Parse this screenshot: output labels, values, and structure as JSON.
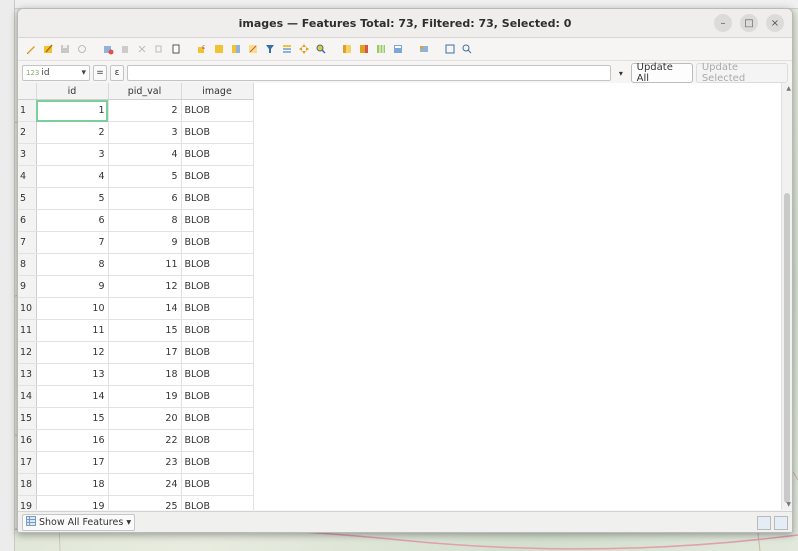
{
  "window": {
    "title": "images — Features Total: 73, Filtered: 73, Selected: 0",
    "controls": {
      "minimize": "–",
      "maximize": "□",
      "close": "×"
    }
  },
  "toolbar": {
    "icons": [
      "pencil-icon",
      "multi-edit-icon",
      "save-icon",
      "reload-icon",
      "add-feature-icon",
      "delete-icon",
      "cut-icon",
      "copy-icon",
      "paste-icon",
      "expression-select-icon",
      "select-all-icon",
      "invert-selection-icon",
      "deselect-icon",
      "filter-icon",
      "move-selection-top-icon",
      "pan-to-selection-icon",
      "zoom-to-selection-icon",
      "new-field-icon",
      "delete-field-icon",
      "organize-columns-icon",
      "field-calculator-icon",
      "conditional-format-icon",
      "actions-icon",
      "dock-icon"
    ]
  },
  "filter": {
    "field_prefix": "123",
    "field_value": "id",
    "equals_label": "=",
    "expression_btn": "ε",
    "expression_value": "",
    "update_all": "Update All",
    "update_selected": "Update Selected"
  },
  "table": {
    "columns": [
      "id",
      "pid_val",
      "image"
    ],
    "rows": [
      {
        "n": "1",
        "id": "1",
        "pid": "2",
        "image": "BLOB"
      },
      {
        "n": "2",
        "id": "2",
        "pid": "3",
        "image": "BLOB"
      },
      {
        "n": "3",
        "id": "3",
        "pid": "4",
        "image": "BLOB"
      },
      {
        "n": "4",
        "id": "4",
        "pid": "5",
        "image": "BLOB"
      },
      {
        "n": "5",
        "id": "5",
        "pid": "6",
        "image": "BLOB"
      },
      {
        "n": "6",
        "id": "6",
        "pid": "8",
        "image": "BLOB"
      },
      {
        "n": "7",
        "id": "7",
        "pid": "9",
        "image": "BLOB"
      },
      {
        "n": "8",
        "id": "8",
        "pid": "11",
        "image": "BLOB"
      },
      {
        "n": "9",
        "id": "9",
        "pid": "12",
        "image": "BLOB"
      },
      {
        "n": "10",
        "id": "10",
        "pid": "14",
        "image": "BLOB"
      },
      {
        "n": "11",
        "id": "11",
        "pid": "15",
        "image": "BLOB"
      },
      {
        "n": "12",
        "id": "12",
        "pid": "17",
        "image": "BLOB"
      },
      {
        "n": "13",
        "id": "13",
        "pid": "18",
        "image": "BLOB"
      },
      {
        "n": "14",
        "id": "14",
        "pid": "19",
        "image": "BLOB"
      },
      {
        "n": "15",
        "id": "15",
        "pid": "20",
        "image": "BLOB"
      },
      {
        "n": "16",
        "id": "16",
        "pid": "22",
        "image": "BLOB"
      },
      {
        "n": "17",
        "id": "17",
        "pid": "23",
        "image": "BLOB"
      },
      {
        "n": "18",
        "id": "18",
        "pid": "24",
        "image": "BLOB"
      },
      {
        "n": "19",
        "id": "19",
        "pid": "25",
        "image": "BLOB"
      }
    ]
  },
  "status": {
    "show_all": "Show All Features"
  }
}
